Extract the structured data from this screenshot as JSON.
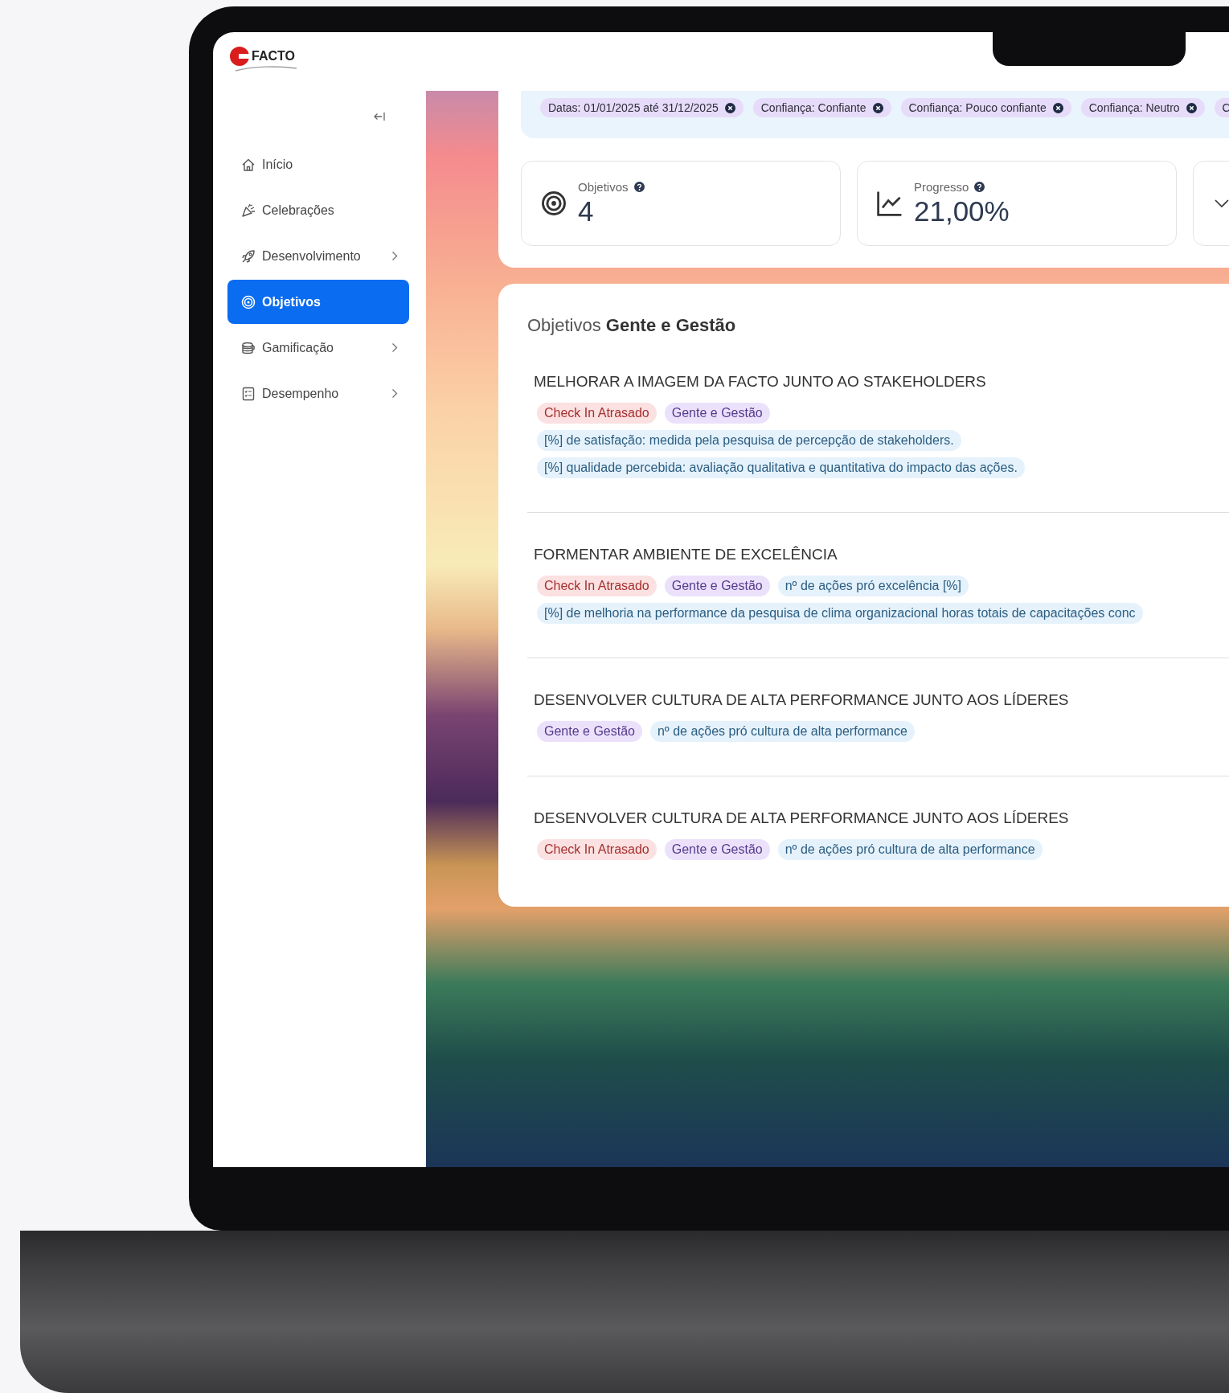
{
  "brand": {
    "name": "FACTO"
  },
  "sidebar": {
    "items": [
      {
        "label": "Início",
        "kind": "home",
        "selected": false,
        "expandable": false
      },
      {
        "label": "Celebrações",
        "kind": "party",
        "selected": false,
        "expandable": false
      },
      {
        "label": "Desenvolvimento",
        "kind": "rocket",
        "selected": false,
        "expandable": true
      },
      {
        "label": "Objetivos",
        "kind": "target",
        "selected": true,
        "expandable": false
      },
      {
        "label": "Gamificação",
        "kind": "coins",
        "selected": false,
        "expandable": true
      },
      {
        "label": "Desempenho",
        "kind": "list",
        "selected": false,
        "expandable": true
      }
    ]
  },
  "filters": [
    "Datas: 01/01/2025 até 31/12/2025",
    "Confiança: Confiante",
    "Confiança: Pouco confiante",
    "Confiança: Neutro",
    "C"
  ],
  "stats": [
    {
      "label": "Objetivos",
      "value": "4",
      "kind": "target"
    },
    {
      "label": "Progresso",
      "value": "21,00%",
      "kind": "chart"
    }
  ],
  "section": {
    "title": "Objetivos **Gente e Gestão**"
  },
  "objectives": [
    {
      "title": "MELHORAR A IMAGEM DA FACTO JUNTO AO STAKEHOLDERS",
      "rows": [
        [
          {
            "text": "Check In Atrasado",
            "kind": "status"
          },
          {
            "text": "Gente e Gestão",
            "kind": "area"
          }
        ],
        [
          {
            "text": "[%] de satisfação: medida pela pesquisa de percepção de stakeholders.",
            "kind": "indicator"
          }
        ],
        [
          {
            "text": "[%] qualidade percebida: avaliação qualitativa e quantitativa do impacto das ações.",
            "kind": "indicator"
          }
        ]
      ]
    },
    {
      "title": "FORMENTAR AMBIENTE DE EXCELÊNCIA",
      "rows": [
        [
          {
            "text": "Check In Atrasado",
            "kind": "status"
          },
          {
            "text": "Gente e Gestão",
            "kind": "area"
          },
          {
            "text": "nº de ações pró excelência [%]",
            "kind": "indicator"
          }
        ],
        [
          {
            "text": "[%] de melhoria na performance da pesquisa de clima organizacional horas totais de capacitações conc",
            "kind": "indicator"
          }
        ]
      ]
    },
    {
      "title": "DESENVOLVER CULTURA DE ALTA PERFORMANCE JUNTO AOS LÍDERES",
      "rows": [
        [
          {
            "text": "Gente e Gestão",
            "kind": "area"
          },
          {
            "text": "nº de ações pró cultura de alta performance",
            "kind": "indicator"
          }
        ]
      ]
    },
    {
      "title": "DESENVOLVER CULTURA DE ALTA PERFORMANCE JUNTO AOS LÍDERES",
      "rows": [
        [
          {
            "text": "Check In Atrasado",
            "kind": "status"
          },
          {
            "text": "Gente e Gestão",
            "kind": "area"
          },
          {
            "text": "nº de ações pró cultura de alta performance",
            "kind": "indicator"
          }
        ]
      ]
    }
  ]
}
